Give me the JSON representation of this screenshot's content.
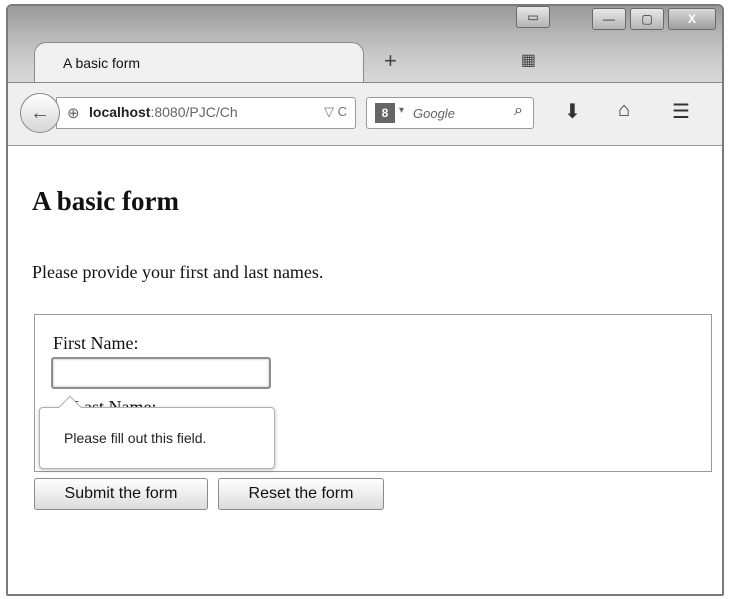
{
  "browser": {
    "tab_title": "A basic form",
    "new_tab_label": "+",
    "url_host": "localhost",
    "url_path": ":8080/PJC/Ch",
    "search_engine_letter": "8",
    "search_placeholder": "Google",
    "window_controls": {
      "minimize": "—",
      "maximize": "▢",
      "close": "X"
    }
  },
  "page": {
    "title": "A basic form",
    "intro": "Please provide your first and last names.",
    "first_name_label": "First Name:",
    "first_name_value": "",
    "last_name_label": "Last Name:",
    "validation_tooltip": "Please fill out this field.",
    "submit_label": "Submit the form",
    "reset_label": "Reset the form"
  }
}
